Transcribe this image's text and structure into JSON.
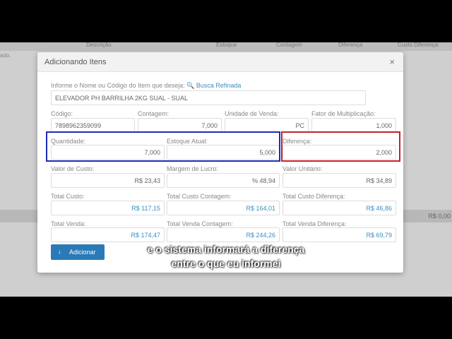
{
  "background": {
    "columns": [
      "Descrição",
      "Estoque",
      "Contagem",
      "Diferença",
      "Custo Diferença"
    ],
    "left_text": "ado.",
    "total": "R$ 0,00"
  },
  "modal": {
    "title": "Adicionando Itens",
    "close": "×",
    "search_label": "Informe o Nome ou Código do Item que deseja:",
    "search_link": "Busca Refinada",
    "item_value": "ELEVADOR PH BARRILHA 2KG SUAL - SUAL",
    "codigo_label": "Código:",
    "codigo_value": "7898962359099",
    "contagem_label": "Contagem:",
    "contagem_value": "7,000",
    "unidade_label": "Unidade de Venda:",
    "unidade_value": "PC",
    "fator_label": "Fator de Multiplicação:",
    "fator_value": "1,000",
    "quantidade_label": "Quantidade:",
    "quantidade_value": "7,000",
    "estoque_label": "Estoque Atual:",
    "estoque_value": "5,000",
    "diferenca_label": "Diferença:",
    "diferenca_value": "2,000",
    "valor_custo_label": "Valor de Custo:",
    "valor_custo_value": "R$  23,43",
    "margem_label": "Margem de Lucro:",
    "margem_value": "%  48,94",
    "valor_unitario_label": "Valor Unitário:",
    "valor_unitario_value": "R$  34,89",
    "total_custo_label": "Total Custo:",
    "total_custo_value": "R$  117,15",
    "total_custo_contagem_label": "Total Custo Contagem:",
    "total_custo_contagem_value": "R$  164,01",
    "total_custo_diferenca_label": "Total Custo Diferença:",
    "total_custo_diferenca_value": "R$  46,86",
    "total_venda_label": "Total Venda:",
    "total_venda_value": "R$  174,47",
    "total_venda_contagem_label": "Total Venda Contagem:",
    "total_venda_contagem_value": "R$  244,26",
    "total_venda_diferenca_label": "Total Venda Diferença:",
    "total_venda_diferenca_value": "R$  69,79",
    "add_button": "Adicionar"
  },
  "subtitles": {
    "line1": "e o sistema informará a diferença",
    "line2": "entre o que eu informei"
  },
  "colors": {
    "accent": "#2a7ab8",
    "link": "#3a8fc4",
    "highlight_blue": "#1f2bb5",
    "highlight_red": "#c0242c"
  }
}
